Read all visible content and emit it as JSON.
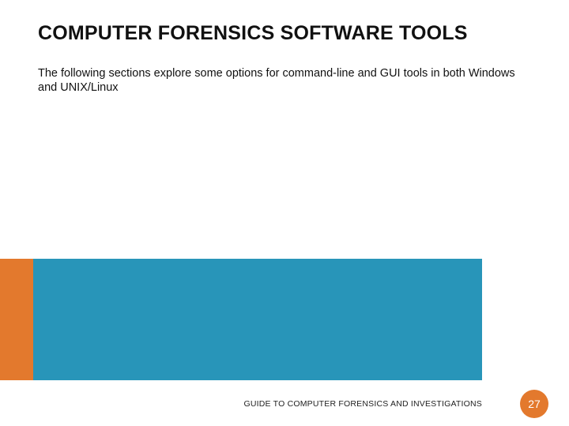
{
  "title": "COMPUTER FORENSICS SOFTWARE TOOLS",
  "body": "The following sections explore some options for command-line and GUI tools in both Windows and UNIX/Linux",
  "footer": "GUIDE TO COMPUTER FORENSICS AND INVESTIGATIONS",
  "page_number": "27",
  "colors": {
    "blue": "#2895b9",
    "orange": "#e3792d"
  }
}
